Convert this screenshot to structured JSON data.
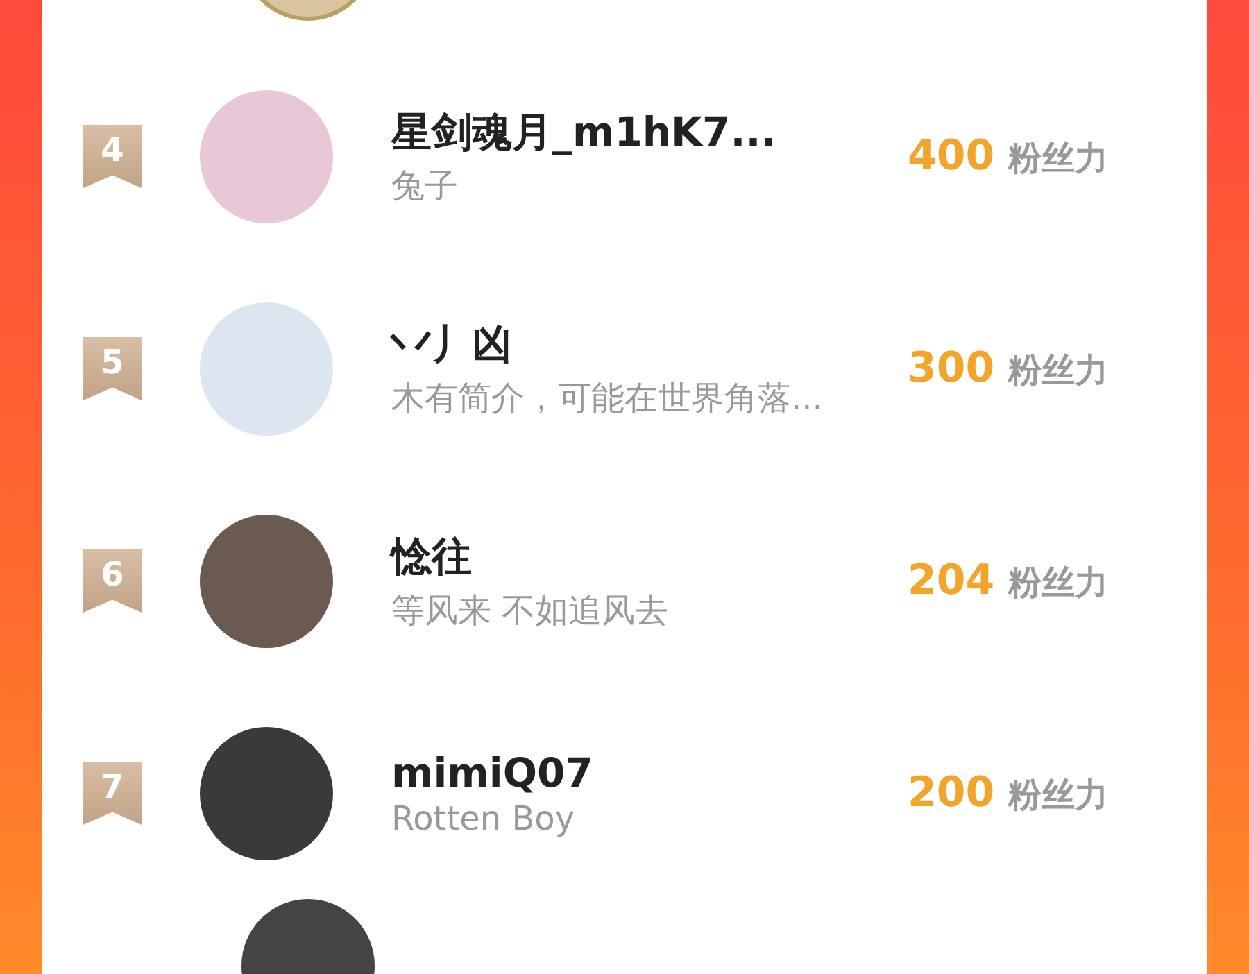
{
  "rankings": [
    {
      "rank": "4",
      "name": "星剑魂月_m1hK7...",
      "bio": "兔子",
      "score": "400",
      "unit": "粉丝力"
    },
    {
      "rank": "5",
      "name": "丷丿凶",
      "bio": "木有简介，可能在世界角落...",
      "score": "300",
      "unit": "粉丝力"
    },
    {
      "rank": "6",
      "name": "惗往",
      "bio": "等风来 不如追风去",
      "score": "204",
      "unit": "粉丝力"
    },
    {
      "rank": "7",
      "name": "mimiQ07",
      "bio": "Rotten Boy",
      "score": "200",
      "unit": "粉丝力"
    }
  ]
}
